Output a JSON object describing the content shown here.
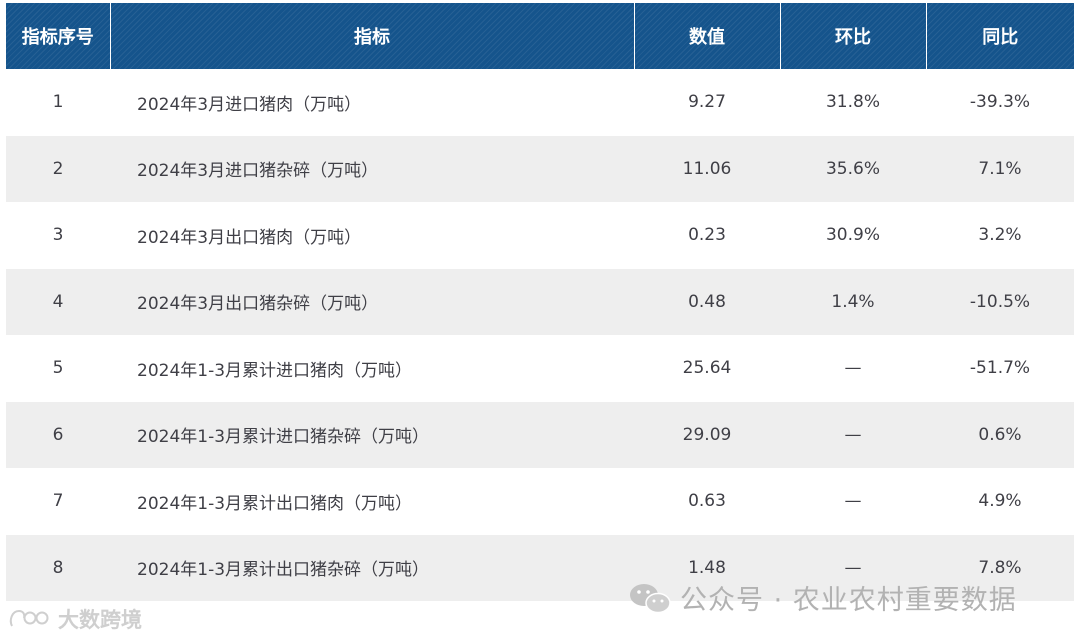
{
  "table": {
    "headers": {
      "index": "指标序号",
      "indicator": "指标",
      "value": "数值",
      "mom": "环比",
      "yoy": "同比"
    },
    "rows": [
      {
        "index": "1",
        "indicator": "2024年3月进口猪肉（万吨）",
        "value": "9.27",
        "mom": "31.8%",
        "yoy": "-39.3%"
      },
      {
        "index": "2",
        "indicator": "2024年3月进口猪杂碎（万吨）",
        "value": "11.06",
        "mom": "35.6%",
        "yoy": "7.1%"
      },
      {
        "index": "3",
        "indicator": "2024年3月出口猪肉（万吨）",
        "value": "0.23",
        "mom": "30.9%",
        "yoy": "3.2%"
      },
      {
        "index": "4",
        "indicator": "2024年3月出口猪杂碎（万吨）",
        "value": "0.48",
        "mom": "1.4%",
        "yoy": "-10.5%"
      },
      {
        "index": "5",
        "indicator": "2024年1-3月累计进口猪肉（万吨）",
        "value": "25.64",
        "mom": "—",
        "yoy": "-51.7%"
      },
      {
        "index": "6",
        "indicator": "2024年1-3月累计进口猪杂碎（万吨）",
        "value": "29.09",
        "mom": "—",
        "yoy": "0.6%"
      },
      {
        "index": "7",
        "indicator": "2024年1-3月累计出口猪肉（万吨）",
        "value": "0.63",
        "mom": "—",
        "yoy": "4.9%"
      },
      {
        "index": "8",
        "indicator": "2024年1-3月累计出口猪杂碎（万吨）",
        "value": "1.48",
        "mom": "—",
        "yoy": "7.8%"
      }
    ]
  },
  "watermark": {
    "text": "公众号 · 农业农村重要数据",
    "icon": "wechat-icon"
  },
  "brand": {
    "text": "大数跨境",
    "icon": "brand-logo-icon"
  },
  "colors": {
    "header_bg": "#15548c",
    "header_text": "#ffffff",
    "row_alt_bg": "#eeeeee",
    "body_text": "#3f3f46"
  }
}
